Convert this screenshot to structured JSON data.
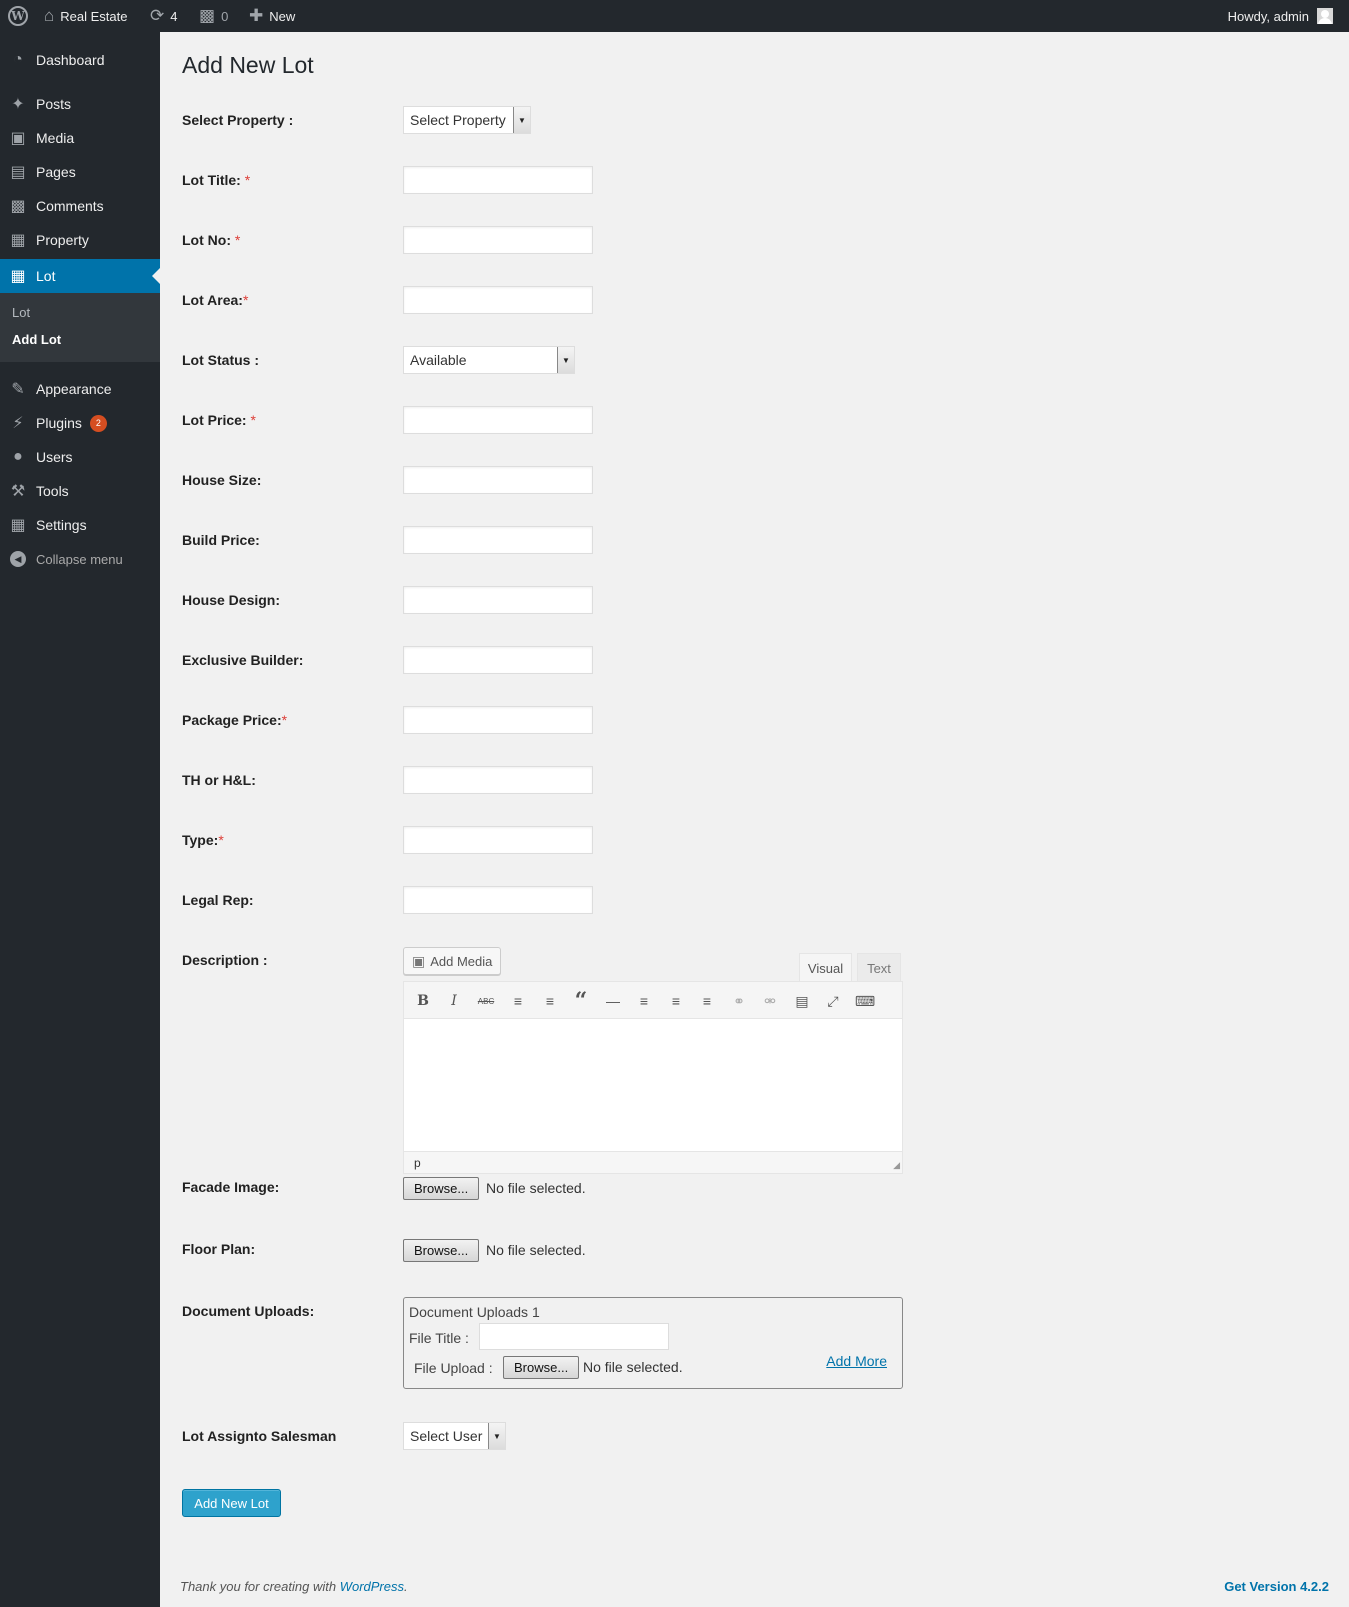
{
  "adminbar": {
    "site_name": "Real Estate",
    "updates_count": "4",
    "comments_count": "0",
    "new_label": "New",
    "howdy": "Howdy, admin",
    "logo_glyph": "W"
  },
  "sidebar": {
    "items": [
      {
        "label": "Dashboard",
        "icon": "dashboard-icon"
      },
      {
        "label": "Posts",
        "icon": "pin-icon"
      },
      {
        "label": "Media",
        "icon": "media-icon"
      },
      {
        "label": "Pages",
        "icon": "pages-icon"
      },
      {
        "label": "Comments",
        "icon": "comment-icon"
      },
      {
        "label": "Property",
        "icon": "map-icon"
      },
      {
        "label": "Lot",
        "icon": "map-icon"
      },
      {
        "label": "Appearance",
        "icon": "brush-icon"
      },
      {
        "label": "Plugins",
        "icon": "plug-icon",
        "badge": "2"
      },
      {
        "label": "Users",
        "icon": "user-icon"
      },
      {
        "label": "Tools",
        "icon": "wrench-icon"
      },
      {
        "label": "Settings",
        "icon": "settings-icon"
      }
    ],
    "submenu": [
      "Lot",
      "Add Lot"
    ],
    "collapse": "Collapse menu"
  },
  "page": {
    "title": "Add New Lot",
    "fields": {
      "select_property": {
        "label": "Select Property :",
        "value": "Select Property"
      },
      "lot_title": {
        "label": "Lot Title: ",
        "req": "*"
      },
      "lot_no": {
        "label": "Lot No: ",
        "req": "*"
      },
      "lot_area": {
        "label": "Lot Area:",
        "req": "*"
      },
      "lot_status": {
        "label": "Lot Status :",
        "value": "Available"
      },
      "lot_price": {
        "label": "Lot Price: ",
        "req": "*"
      },
      "house_size": {
        "label": "House Size:"
      },
      "build_price": {
        "label": "Build Price:"
      },
      "house_design": {
        "label": "House Design:"
      },
      "exclusive_builder": {
        "label": "Exclusive Builder:"
      },
      "package_price": {
        "label": "Package Price:",
        "req": "*"
      },
      "th_hl": {
        "label": "TH or H&L:"
      },
      "type": {
        "label": "Type:",
        "req": "*"
      },
      "legal_rep": {
        "label": "Legal Rep:"
      },
      "description": {
        "label": "Description :"
      },
      "facade_image": {
        "label": "Facade Image:"
      },
      "floor_plan": {
        "label": "Floor Plan:"
      },
      "document_uploads": {
        "label": "Document Uploads:"
      },
      "salesman": {
        "label": "Lot Assignto Salesman",
        "value": "Select User"
      }
    },
    "editor": {
      "add_media": "Add Media",
      "tab_visual": "Visual",
      "tab_text": "Text",
      "path": "p"
    },
    "browse_label": "Browse...",
    "no_file": "No file selected.",
    "doc_box": {
      "heading": "Document Uploads 1",
      "file_title": "File Title :",
      "file_upload": "File Upload :",
      "add_more": "Add More"
    },
    "submit": "Add New Lot"
  },
  "footer": {
    "thanks_prefix": "Thank you for creating with ",
    "wp_link": "WordPress",
    "thanks_suffix": ".",
    "version": "Get Version 4.2.2"
  }
}
